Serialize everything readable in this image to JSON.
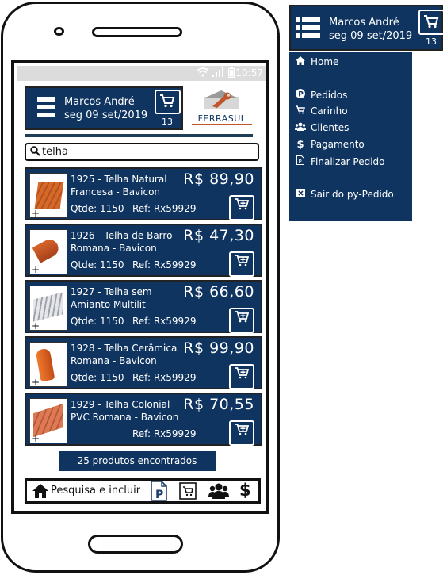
{
  "status_bar": {
    "time": "10:57"
  },
  "header": {
    "user_name": "Marcos André",
    "date": "seg 09 set/2019",
    "cart_count": "13"
  },
  "brand": {
    "logo_text": "FERRASUL"
  },
  "search": {
    "value": "telha"
  },
  "products": [
    {
      "code_title": "1925 - Telha Natural Francesa - Bavicon",
      "price": "R$ 89,90",
      "qtde": "Qtde: 1150",
      "ref": "Ref: Rx59929",
      "tile_color": "#d4692a"
    },
    {
      "code_title": "1926 - Telha de Barro Romana - Bavicon",
      "price": "R$ 47,30",
      "qtde": "Qtde: 1150",
      "ref": "Ref: Rx59929",
      "tile_color": "#c9541d"
    },
    {
      "code_title": "1927 - Telha sem Amianto Multilit",
      "price": "R$ 66,60",
      "qtde": "Qtde: 1150",
      "ref": "Ref: Rx59929",
      "tile_color": "#b8bcc2"
    },
    {
      "code_title": "1928 - Telha Cerâmica Romana - Bavicon",
      "price": "R$ 99,90",
      "qtde": "Qtde: 1150",
      "ref": "Ref: Rx59929",
      "tile_color": "#e0621f"
    },
    {
      "code_title": "1929 - Telha Colonial PVC Romana - Bavicon",
      "price": "R$ 70,55",
      "qtde": "",
      "ref": "Ref: Rx59929",
      "tile_color": "#d9704a"
    }
  ],
  "results_text": "25 produtos encontrados",
  "bottom_bar": {
    "search_include_label": "Pesquisa e incluir"
  },
  "side_menu": {
    "user_name": "Marcos André",
    "date": "seg 09 set/2019",
    "cart_count": "13",
    "separator": "------------------------",
    "items": [
      {
        "label": "Home",
        "icon": "home-icon"
      },
      {
        "label": "Pedidos",
        "icon": "p-circle-icon"
      },
      {
        "label": "Carinho",
        "icon": "cart-icon"
      },
      {
        "label": "Clientes",
        "icon": "users-icon"
      },
      {
        "label": "Pagamento",
        "icon": "dollar-icon"
      },
      {
        "label": "Finalizar Pedido",
        "icon": "document-icon"
      },
      {
        "label": "Sair do py-Pedido",
        "icon": "close-box-icon"
      }
    ]
  },
  "colors": {
    "navy": "#0f3460",
    "accent_orange": "#c0562a"
  }
}
